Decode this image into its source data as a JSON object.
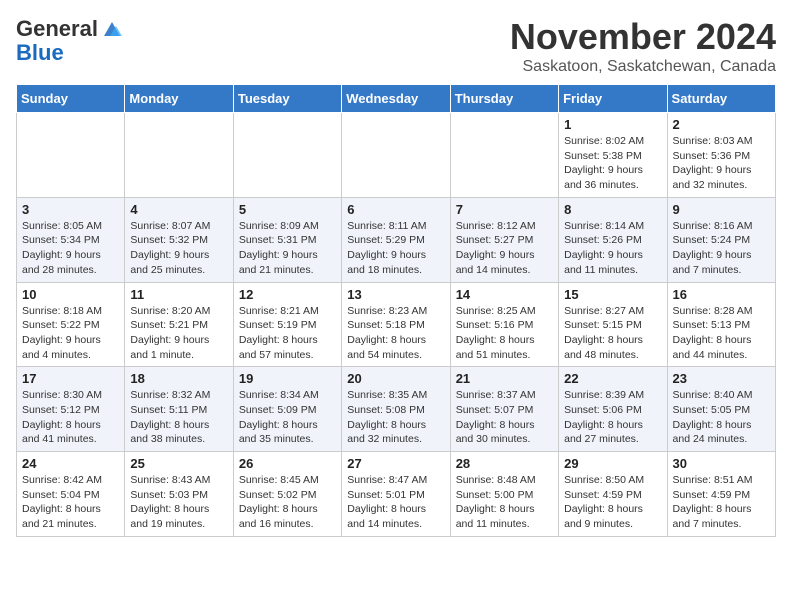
{
  "header": {
    "logo_general": "General",
    "logo_blue": "Blue",
    "month": "November 2024",
    "location": "Saskatoon, Saskatchewan, Canada"
  },
  "weekdays": [
    "Sunday",
    "Monday",
    "Tuesday",
    "Wednesday",
    "Thursday",
    "Friday",
    "Saturday"
  ],
  "weeks": [
    [
      {
        "day": "",
        "info": ""
      },
      {
        "day": "",
        "info": ""
      },
      {
        "day": "",
        "info": ""
      },
      {
        "day": "",
        "info": ""
      },
      {
        "day": "",
        "info": ""
      },
      {
        "day": "1",
        "info": "Sunrise: 8:02 AM\nSunset: 5:38 PM\nDaylight: 9 hours and 36 minutes."
      },
      {
        "day": "2",
        "info": "Sunrise: 8:03 AM\nSunset: 5:36 PM\nDaylight: 9 hours and 32 minutes."
      }
    ],
    [
      {
        "day": "3",
        "info": "Sunrise: 8:05 AM\nSunset: 5:34 PM\nDaylight: 9 hours and 28 minutes."
      },
      {
        "day": "4",
        "info": "Sunrise: 8:07 AM\nSunset: 5:32 PM\nDaylight: 9 hours and 25 minutes."
      },
      {
        "day": "5",
        "info": "Sunrise: 8:09 AM\nSunset: 5:31 PM\nDaylight: 9 hours and 21 minutes."
      },
      {
        "day": "6",
        "info": "Sunrise: 8:11 AM\nSunset: 5:29 PM\nDaylight: 9 hours and 18 minutes."
      },
      {
        "day": "7",
        "info": "Sunrise: 8:12 AM\nSunset: 5:27 PM\nDaylight: 9 hours and 14 minutes."
      },
      {
        "day": "8",
        "info": "Sunrise: 8:14 AM\nSunset: 5:26 PM\nDaylight: 9 hours and 11 minutes."
      },
      {
        "day": "9",
        "info": "Sunrise: 8:16 AM\nSunset: 5:24 PM\nDaylight: 9 hours and 7 minutes."
      }
    ],
    [
      {
        "day": "10",
        "info": "Sunrise: 8:18 AM\nSunset: 5:22 PM\nDaylight: 9 hours and 4 minutes."
      },
      {
        "day": "11",
        "info": "Sunrise: 8:20 AM\nSunset: 5:21 PM\nDaylight: 9 hours and 1 minute."
      },
      {
        "day": "12",
        "info": "Sunrise: 8:21 AM\nSunset: 5:19 PM\nDaylight: 8 hours and 57 minutes."
      },
      {
        "day": "13",
        "info": "Sunrise: 8:23 AM\nSunset: 5:18 PM\nDaylight: 8 hours and 54 minutes."
      },
      {
        "day": "14",
        "info": "Sunrise: 8:25 AM\nSunset: 5:16 PM\nDaylight: 8 hours and 51 minutes."
      },
      {
        "day": "15",
        "info": "Sunrise: 8:27 AM\nSunset: 5:15 PM\nDaylight: 8 hours and 48 minutes."
      },
      {
        "day": "16",
        "info": "Sunrise: 8:28 AM\nSunset: 5:13 PM\nDaylight: 8 hours and 44 minutes."
      }
    ],
    [
      {
        "day": "17",
        "info": "Sunrise: 8:30 AM\nSunset: 5:12 PM\nDaylight: 8 hours and 41 minutes."
      },
      {
        "day": "18",
        "info": "Sunrise: 8:32 AM\nSunset: 5:11 PM\nDaylight: 8 hours and 38 minutes."
      },
      {
        "day": "19",
        "info": "Sunrise: 8:34 AM\nSunset: 5:09 PM\nDaylight: 8 hours and 35 minutes."
      },
      {
        "day": "20",
        "info": "Sunrise: 8:35 AM\nSunset: 5:08 PM\nDaylight: 8 hours and 32 minutes."
      },
      {
        "day": "21",
        "info": "Sunrise: 8:37 AM\nSunset: 5:07 PM\nDaylight: 8 hours and 30 minutes."
      },
      {
        "day": "22",
        "info": "Sunrise: 8:39 AM\nSunset: 5:06 PM\nDaylight: 8 hours and 27 minutes."
      },
      {
        "day": "23",
        "info": "Sunrise: 8:40 AM\nSunset: 5:05 PM\nDaylight: 8 hours and 24 minutes."
      }
    ],
    [
      {
        "day": "24",
        "info": "Sunrise: 8:42 AM\nSunset: 5:04 PM\nDaylight: 8 hours and 21 minutes."
      },
      {
        "day": "25",
        "info": "Sunrise: 8:43 AM\nSunset: 5:03 PM\nDaylight: 8 hours and 19 minutes."
      },
      {
        "day": "26",
        "info": "Sunrise: 8:45 AM\nSunset: 5:02 PM\nDaylight: 8 hours and 16 minutes."
      },
      {
        "day": "27",
        "info": "Sunrise: 8:47 AM\nSunset: 5:01 PM\nDaylight: 8 hours and 14 minutes."
      },
      {
        "day": "28",
        "info": "Sunrise: 8:48 AM\nSunset: 5:00 PM\nDaylight: 8 hours and 11 minutes."
      },
      {
        "day": "29",
        "info": "Sunrise: 8:50 AM\nSunset: 4:59 PM\nDaylight: 8 hours and 9 minutes."
      },
      {
        "day": "30",
        "info": "Sunrise: 8:51 AM\nSunset: 4:59 PM\nDaylight: 8 hours and 7 minutes."
      }
    ]
  ]
}
